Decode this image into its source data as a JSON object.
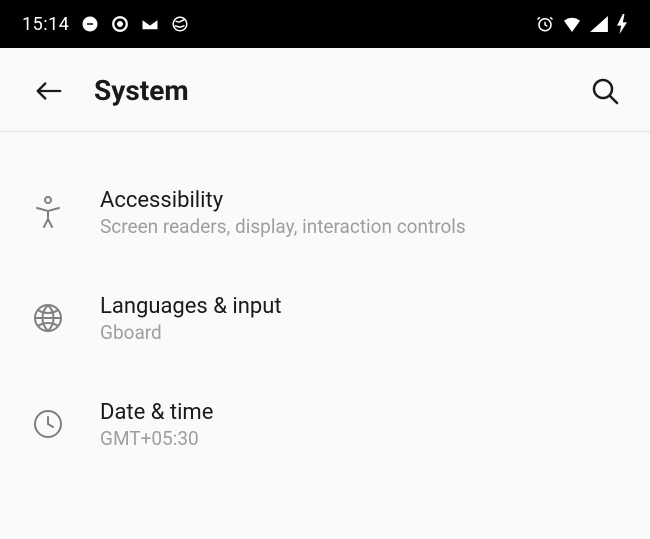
{
  "status": {
    "time": "15:14"
  },
  "header": {
    "title": "System"
  },
  "settings": [
    {
      "title": "Accessibility",
      "subtitle": "Screen readers, display, interaction controls"
    },
    {
      "title": "Languages & input",
      "subtitle": "Gboard"
    },
    {
      "title": "Date & time",
      "subtitle": "GMT+05:30"
    }
  ]
}
